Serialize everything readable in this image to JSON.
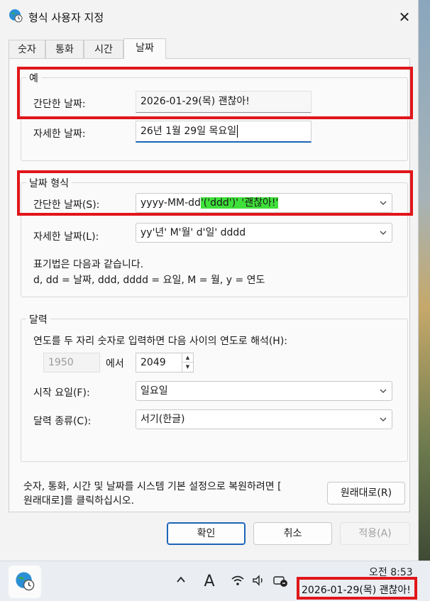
{
  "window": {
    "title": "형식 사용자 지정",
    "close_glyph": "✕"
  },
  "tabs": [
    "숫자",
    "통화",
    "시간",
    "날짜"
  ],
  "example": {
    "legend": "예",
    "short_label": "간단한 날짜:",
    "short_value": "2026-01-29(목) 괜찮아!",
    "long_label": "자세한 날짜:",
    "long_value": "26년 1월 29일 목요일"
  },
  "date_format": {
    "legend": "날짜 형식",
    "short_label": "간단한 날짜(S):",
    "short_value_plain": "yyyy-MM-dd",
    "short_value_highlight": "'('ddd')' '괜찮아!'",
    "long_label": "자세한 날짜(L):",
    "long_value": "yy'년' M'월' d'일' dddd",
    "notation_line1": "표기법은 다음과 같습니다.",
    "notation_line2": "d, dd = 날짜,  ddd, dddd = 요일,  M = 월,  y = 연도"
  },
  "calendar": {
    "legend": "달력",
    "two_digit_label": "연도를 두 자리 숫자로 입력하면 다음 사이의 연도로 해석(H):",
    "year_from": "1950",
    "from_suffix": "에서",
    "year_to": "2049",
    "first_day_label": "시작 요일(F):",
    "first_day_value": "일요일",
    "calendar_type_label": "달력 종류(C):",
    "calendar_type_value": "서기(한글)"
  },
  "reset": {
    "text_line1": "숫자, 통화, 시간 및 날짜를 시스템 기본 설정으로 복원하려면 [",
    "text_line2": "원래대로]를 클릭하십시오.",
    "button": "원래대로(R)"
  },
  "buttons": {
    "ok": "확인",
    "cancel": "취소",
    "apply": "적용(A)"
  },
  "taskbar": {
    "time": "오전 8:53",
    "date": "2026-01-29(목) 괜찮아!",
    "icons": [
      "chevron-up-icon",
      "ime-icon",
      "wifi-icon",
      "volume-icon",
      "notification-icon"
    ],
    "ime_glyph": "A"
  },
  "colors": {
    "highlight": "#e0161b",
    "text_highlight": "#3fe03a",
    "accent": "#1c64b6"
  }
}
